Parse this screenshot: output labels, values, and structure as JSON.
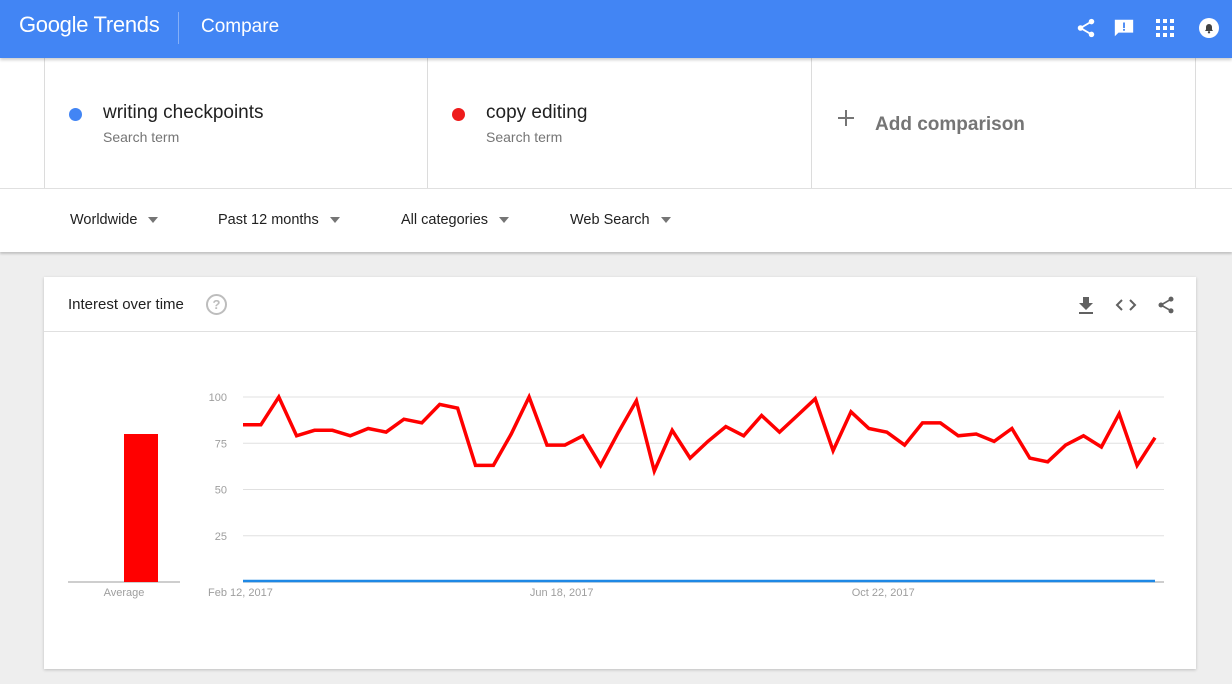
{
  "header": {
    "logo_text": "Google Trends",
    "page_label": "Compare",
    "icons": [
      "share-icon",
      "feedback-icon",
      "apps-grid-icon",
      "notifications-bell-icon"
    ],
    "brand_color": "#4285f4"
  },
  "terms": [
    {
      "name": "writing checkpoints",
      "type": "Search term",
      "color": "#4285f4"
    },
    {
      "name": "copy editing",
      "type": "Search term",
      "color": "#ee1c1c"
    }
  ],
  "add_comparison": {
    "label": "Add comparison",
    "icon": "plus-icon"
  },
  "filters": [
    {
      "label": "Worldwide"
    },
    {
      "label": "Past 12 months"
    },
    {
      "label": "All categories"
    },
    {
      "label": "Web Search"
    }
  ],
  "card": {
    "title": "Interest over time",
    "help_icon": "?",
    "actions": [
      "download-icon",
      "embed-code-icon",
      "share-icon"
    ]
  },
  "chart_data": {
    "type": "line",
    "title": "Interest over time",
    "xlabel": "",
    "ylabel": "",
    "ylim": [
      0,
      100
    ],
    "yticks": [
      25,
      50,
      75,
      100
    ],
    "grid": true,
    "x_tick_labels": [
      {
        "label": "Feb 12, 2017",
        "index": 0
      },
      {
        "label": "Jun 18, 2017",
        "index": 18
      },
      {
        "label": "Oct 22, 2017",
        "index": 36
      }
    ],
    "average": {
      "label": "Average",
      "series": [
        {
          "name": "writing checkpoints",
          "value": 0,
          "color": "#4285f4"
        },
        {
          "name": "copy editing",
          "value": 80,
          "color": "#ff0000"
        }
      ]
    },
    "series": [
      {
        "name": "writing checkpoints",
        "color": "#1e88e5",
        "values": [
          0,
          0,
          0,
          0,
          0,
          0,
          0,
          0,
          0,
          0,
          0,
          0,
          0,
          0,
          0,
          0,
          0,
          0,
          0,
          0,
          0,
          0,
          0,
          0,
          0,
          0,
          0,
          0,
          0,
          0,
          0,
          0,
          0,
          0,
          0,
          0,
          0,
          0,
          0,
          0,
          0,
          0,
          0,
          0,
          0,
          0,
          0,
          0,
          0,
          0,
          0,
          0
        ]
      },
      {
        "name": "copy editing",
        "color": "#ff0000",
        "values": [
          85,
          85,
          100,
          79,
          82,
          82,
          79,
          83,
          81,
          88,
          86,
          96,
          94,
          63,
          63,
          80,
          100,
          74,
          74,
          79,
          63,
          81,
          98,
          60,
          82,
          67,
          76,
          84,
          79,
          90,
          81,
          90,
          99,
          71,
          92,
          83,
          81,
          74,
          86,
          86,
          79,
          80,
          76,
          83,
          67,
          65,
          74,
          79,
          73,
          91,
          63,
          78
        ]
      }
    ]
  }
}
